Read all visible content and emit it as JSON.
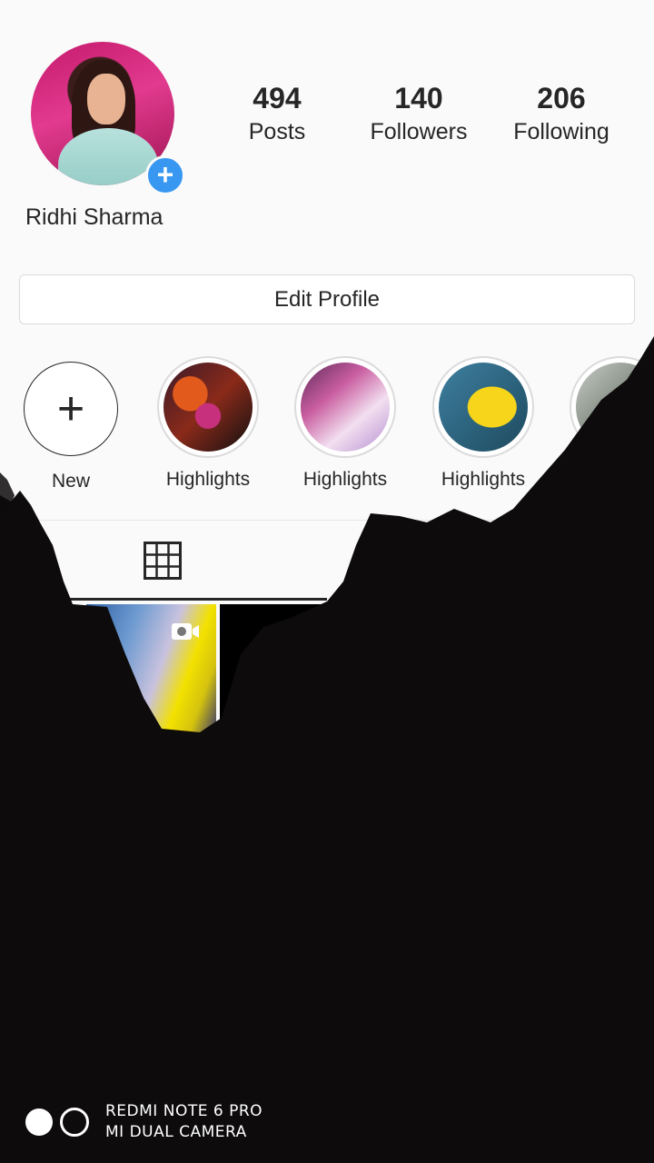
{
  "profile": {
    "name": "Ridhi Sharma",
    "stats": [
      {
        "value": "494",
        "label": "Posts"
      },
      {
        "value": "140",
        "label": "Followers"
      },
      {
        "value": "206",
        "label": "Following"
      }
    ],
    "edit_label": "Edit Profile",
    "add_icon": "+"
  },
  "highlights": {
    "new_label": "New",
    "new_icon": "+",
    "items": [
      {
        "label": "Highlights"
      },
      {
        "label": "Highlights"
      },
      {
        "label": "Highlights"
      },
      {
        "label": ""
      }
    ]
  },
  "tabs": {
    "active": "grid",
    "icon": "grid-icon"
  },
  "watermark": {
    "line1": "REDMI NOTE 6 PRO",
    "line2": "MI DUAL CAMERA"
  },
  "colors": {
    "accent": "#3897f0",
    "background": "#fafafa",
    "text": "#262626",
    "overlay": "#0d0b0b"
  }
}
